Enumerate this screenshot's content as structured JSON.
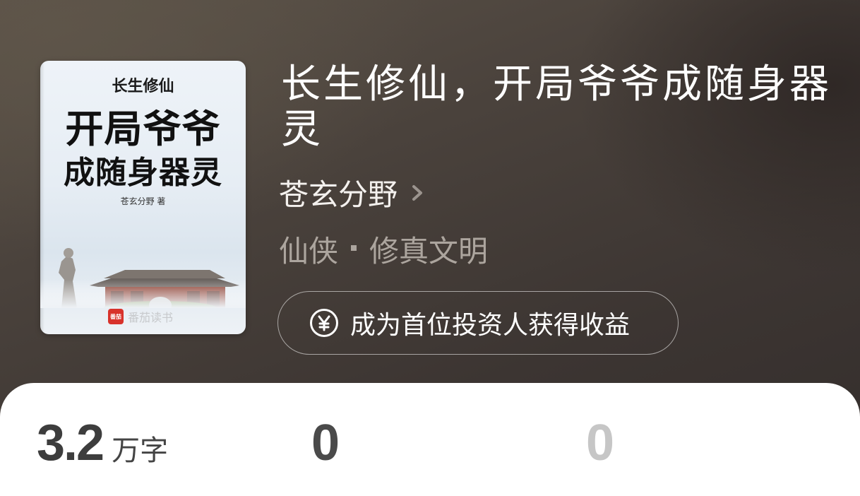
{
  "cover": {
    "small_title": "长生修仙",
    "big_title_line1": "开局爷爷",
    "big_title_line2": "成随身器灵",
    "author_text": "苍玄分野 著",
    "publisher_badge": "番茄",
    "publisher_name": "番茄读书"
  },
  "book": {
    "title": "长生修仙，开局爷爷成随身器灵",
    "author": "苍玄分野",
    "genre_main": "仙侠",
    "genre_sub": "修真文明"
  },
  "invest": {
    "label": "成为首位投资人获得收益",
    "icon": "yen-circle-icon"
  },
  "stats": {
    "words_value": "3.2",
    "words_unit": "万字",
    "stat2_value": "0",
    "stat3_value": "0"
  },
  "colors": {
    "hero_bg": "#3d3632",
    "sheet_bg": "#ffffff",
    "text_primary": "#ffffff",
    "text_muted": "#aca59e",
    "stat_dim": "#c6c6c6"
  }
}
